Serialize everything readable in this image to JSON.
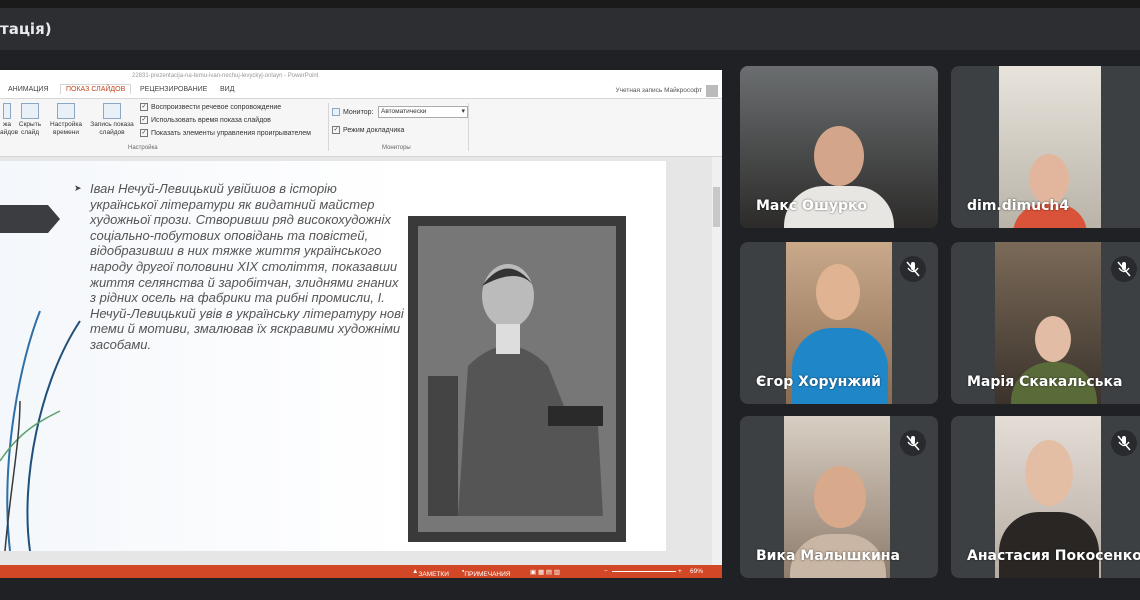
{
  "window": {
    "title": "тація)"
  },
  "ppt": {
    "filename": "22831-prezentacija-na-temu-ivan-nechuj-levyckyj-onlayn - PowerPoint",
    "tabs": [
      "АНИМАЦИЯ",
      "ПОКАЗ СЛАЙДОВ",
      "РЕЦЕНЗИРОВАНИЕ",
      "ВИД"
    ],
    "active_tab": "ПОКАЗ СЛАЙДОВ",
    "account": "Учетная запись Майкрософт",
    "ribbon_buttons": [
      "жа",
      "айдов",
      "Скрыть слайд",
      "Настройка времени",
      "Запись показа слайдов"
    ],
    "ribbon_checks": [
      "Воспроизвести речевое сопровождение",
      "Использовать время показа слайдов",
      "Показать элементы управления проигрывателем"
    ],
    "ribbon_group_setup": "Настройка",
    "monitor_label": "Монитор:",
    "monitor_value": "Автоматически",
    "presenter_view": "Режим докладчика",
    "ribbon_group_monitors": "Мониторы",
    "slide_text": "Іван Нечуй-Левицький увійшов в історію української літератури як видатний майстер художньої прози. Створивши ряд високохудожніх соціально-побутових оповідань та повістей, відобразивши в них тяжке життя українського народу другої половини XIX століття, показавши життя селянства й заробітчан, злиднями гнаних з рідних осель на фабрики та рибні промисли, І. Нечуй-Левицький увів в українську літературу нові теми й мотиви, змалював їх яскравими художніми засобами.",
    "status_notes": "ЗАМЕТКИ",
    "status_comments": "ПРИМЕЧАНИЯ",
    "zoom": "69%"
  },
  "participants": [
    {
      "name": "Макс Ошурко",
      "muted": false
    },
    {
      "name": "dim.dimuch4",
      "muted": false
    },
    {
      "name": "Єгор Хорунжий",
      "muted": true
    },
    {
      "name": "Марія Скакальська",
      "muted": true
    },
    {
      "name": "Вика Малышкина",
      "muted": true
    },
    {
      "name": "Анастасия Покосенко",
      "muted": true
    }
  ]
}
